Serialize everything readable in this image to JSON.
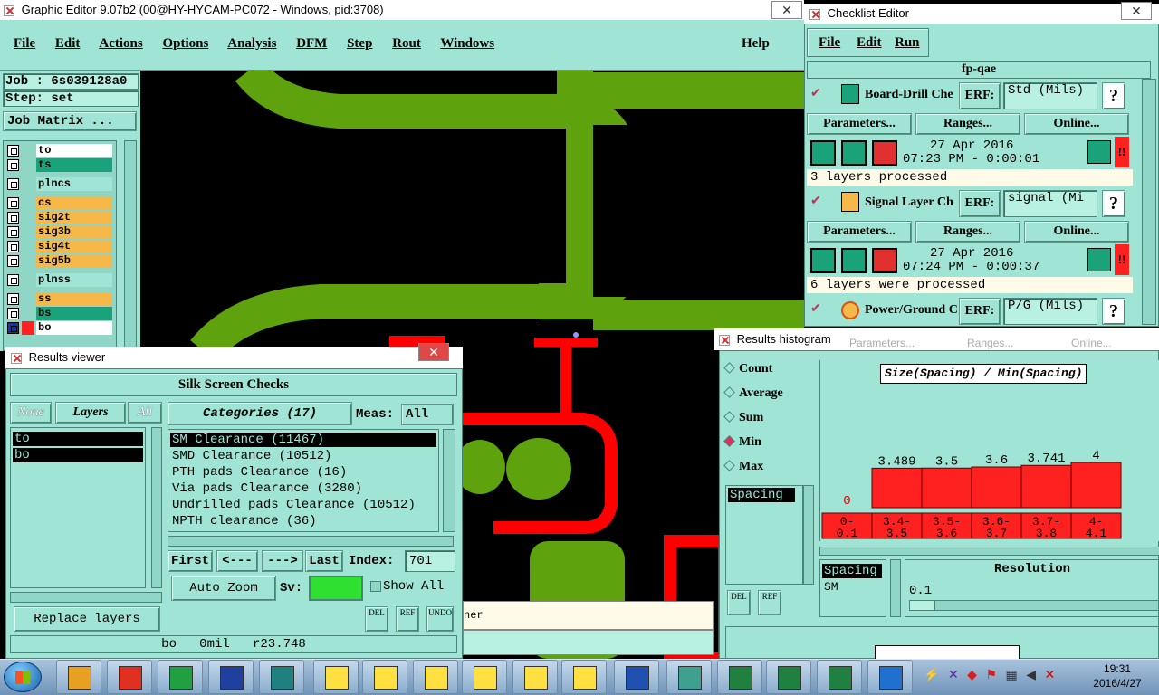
{
  "main_window": {
    "title": "Graphic Editor 9.07b2 (00@HY-HYCAM-PC072 - Windows, pid:3708)",
    "menu": [
      "File",
      "Edit",
      "Actions",
      "Options",
      "Analysis",
      "DFM",
      "Step",
      "Rout",
      "Windows"
    ],
    "help": "Help",
    "job": "Job : 6s039128a0",
    "step": "Step: set",
    "job_matrix": "Job Matrix ...",
    "layers": [
      {
        "name": "to",
        "color": "#ffffff"
      },
      {
        "name": "ts",
        "color": "#1aa37a"
      },
      {
        "name": "plncs",
        "color": "#9fe4d4"
      },
      {
        "name": "cs",
        "color": "#f7b84a"
      },
      {
        "name": "sig2t",
        "color": "#f7b84a"
      },
      {
        "name": "sig3b",
        "color": "#f7b84a"
      },
      {
        "name": "sig4t",
        "color": "#f7b84a"
      },
      {
        "name": "sig5b",
        "color": "#f7b84a"
      },
      {
        "name": "plnss",
        "color": "#9fe4d4"
      },
      {
        "name": "ss",
        "color": "#f7b84a"
      },
      {
        "name": "bs",
        "color": "#1aa37a"
      },
      {
        "name": "bo",
        "color": "#ffffff"
      }
    ],
    "partial_text": "ner"
  },
  "checklist_editor": {
    "title": "Checklist Editor",
    "menu": [
      "File",
      "Edit",
      "Run"
    ],
    "checklist_name": "fp-qae",
    "actions": [
      {
        "name": "Board-Drill Che",
        "erf_label": "ERF:",
        "erf_value": "Std (Mils)",
        "params": "Parameters...",
        "ranges": "Ranges...",
        "online": "Online...",
        "date": "27 Apr 2016",
        "time": "07:23 PM - 0:00:01",
        "status": "3 layers processed"
      },
      {
        "name": "Signal Layer Ch",
        "erf_label": "ERF:",
        "erf_value": "signal (Mi",
        "params": "Parameters...",
        "ranges": "Ranges...",
        "online": "Online...",
        "date": "27 Apr 2016",
        "time": "07:24 PM - 0:00:37",
        "status": "6 layers were processed"
      },
      {
        "name": "Power/Ground C",
        "erf_label": "ERF:",
        "erf_value": "P/G (Mils)"
      }
    ],
    "question": "?",
    "alert": "!!"
  },
  "results_viewer": {
    "title": "Results viewer",
    "header": "Silk Screen Checks",
    "none": "None",
    "layers_label": "Layers",
    "all": "All",
    "layer_items": [
      "to",
      "bo"
    ],
    "categories_label": "Categories (17)",
    "meas_label": "Meas:",
    "meas_value": "All",
    "categories": [
      "SM Clearance (11467)",
      "SMD Clearance (10512)",
      "PTH pads Clearance (16)",
      "Via pads Clearance (3280)",
      "Undrilled pads Clearance (10512)",
      "NPTH clearance (36)"
    ],
    "first": "First",
    "prev": "<---",
    "next": "--->",
    "last": "Last",
    "index_label": "Index:",
    "index_value": "701",
    "auto_zoom": "Auto Zoom",
    "sv_label": "Sv:",
    "show_all": "Show All",
    "replace_layers": "Replace layers",
    "del": "DEL",
    "ref": "REF",
    "undo": "UNDO",
    "status": "bo   0mil   r23.748"
  },
  "histogram": {
    "title": "Results histogram",
    "options": [
      "Count",
      "Average",
      "Sum",
      "Min",
      "Max"
    ],
    "selected_option": "Min",
    "chart_title": "Size(Spacing) / Min(Spacing)",
    "list_item": "Spacing",
    "list2": [
      "Spacing",
      "SM"
    ],
    "resolution_label": "Resolution",
    "resolution_value": "0.1",
    "del": "DEL",
    "ref": "REF",
    "faded_labels": [
      "Parameters...",
      "Ranges...",
      "Online..."
    ]
  },
  "chart_data": {
    "type": "bar",
    "title": "Size(Spacing) / Min(Spacing)",
    "categories": [
      "0-\n0.1",
      "3.4-\n3.5",
      "3.5-\n3.6",
      "3.6-\n3.7",
      "3.7-\n3.8",
      "4-\n4.1"
    ],
    "cat_top": [
      "0-",
      "3.4-",
      "3.5-",
      "3.6-",
      "3.7-",
      "4-"
    ],
    "cat_bottom": [
      "0.1",
      "3.5",
      "3.6",
      "3.7",
      "3.8",
      "4.1"
    ],
    "values": [
      0,
      3.489,
      3.5,
      3.6,
      3.741,
      4
    ],
    "value_labels": [
      "0",
      "3.489",
      "3.5",
      "3.6",
      "3.741",
      "4"
    ],
    "bar_color": "#ff2020"
  },
  "taskbar": {
    "time": "19:31",
    "date": "2016/4/27"
  },
  "colors": {
    "teal": "#9fe4d4",
    "pcb_green": "#5ea30e",
    "pcb_red": "#ff0000"
  }
}
